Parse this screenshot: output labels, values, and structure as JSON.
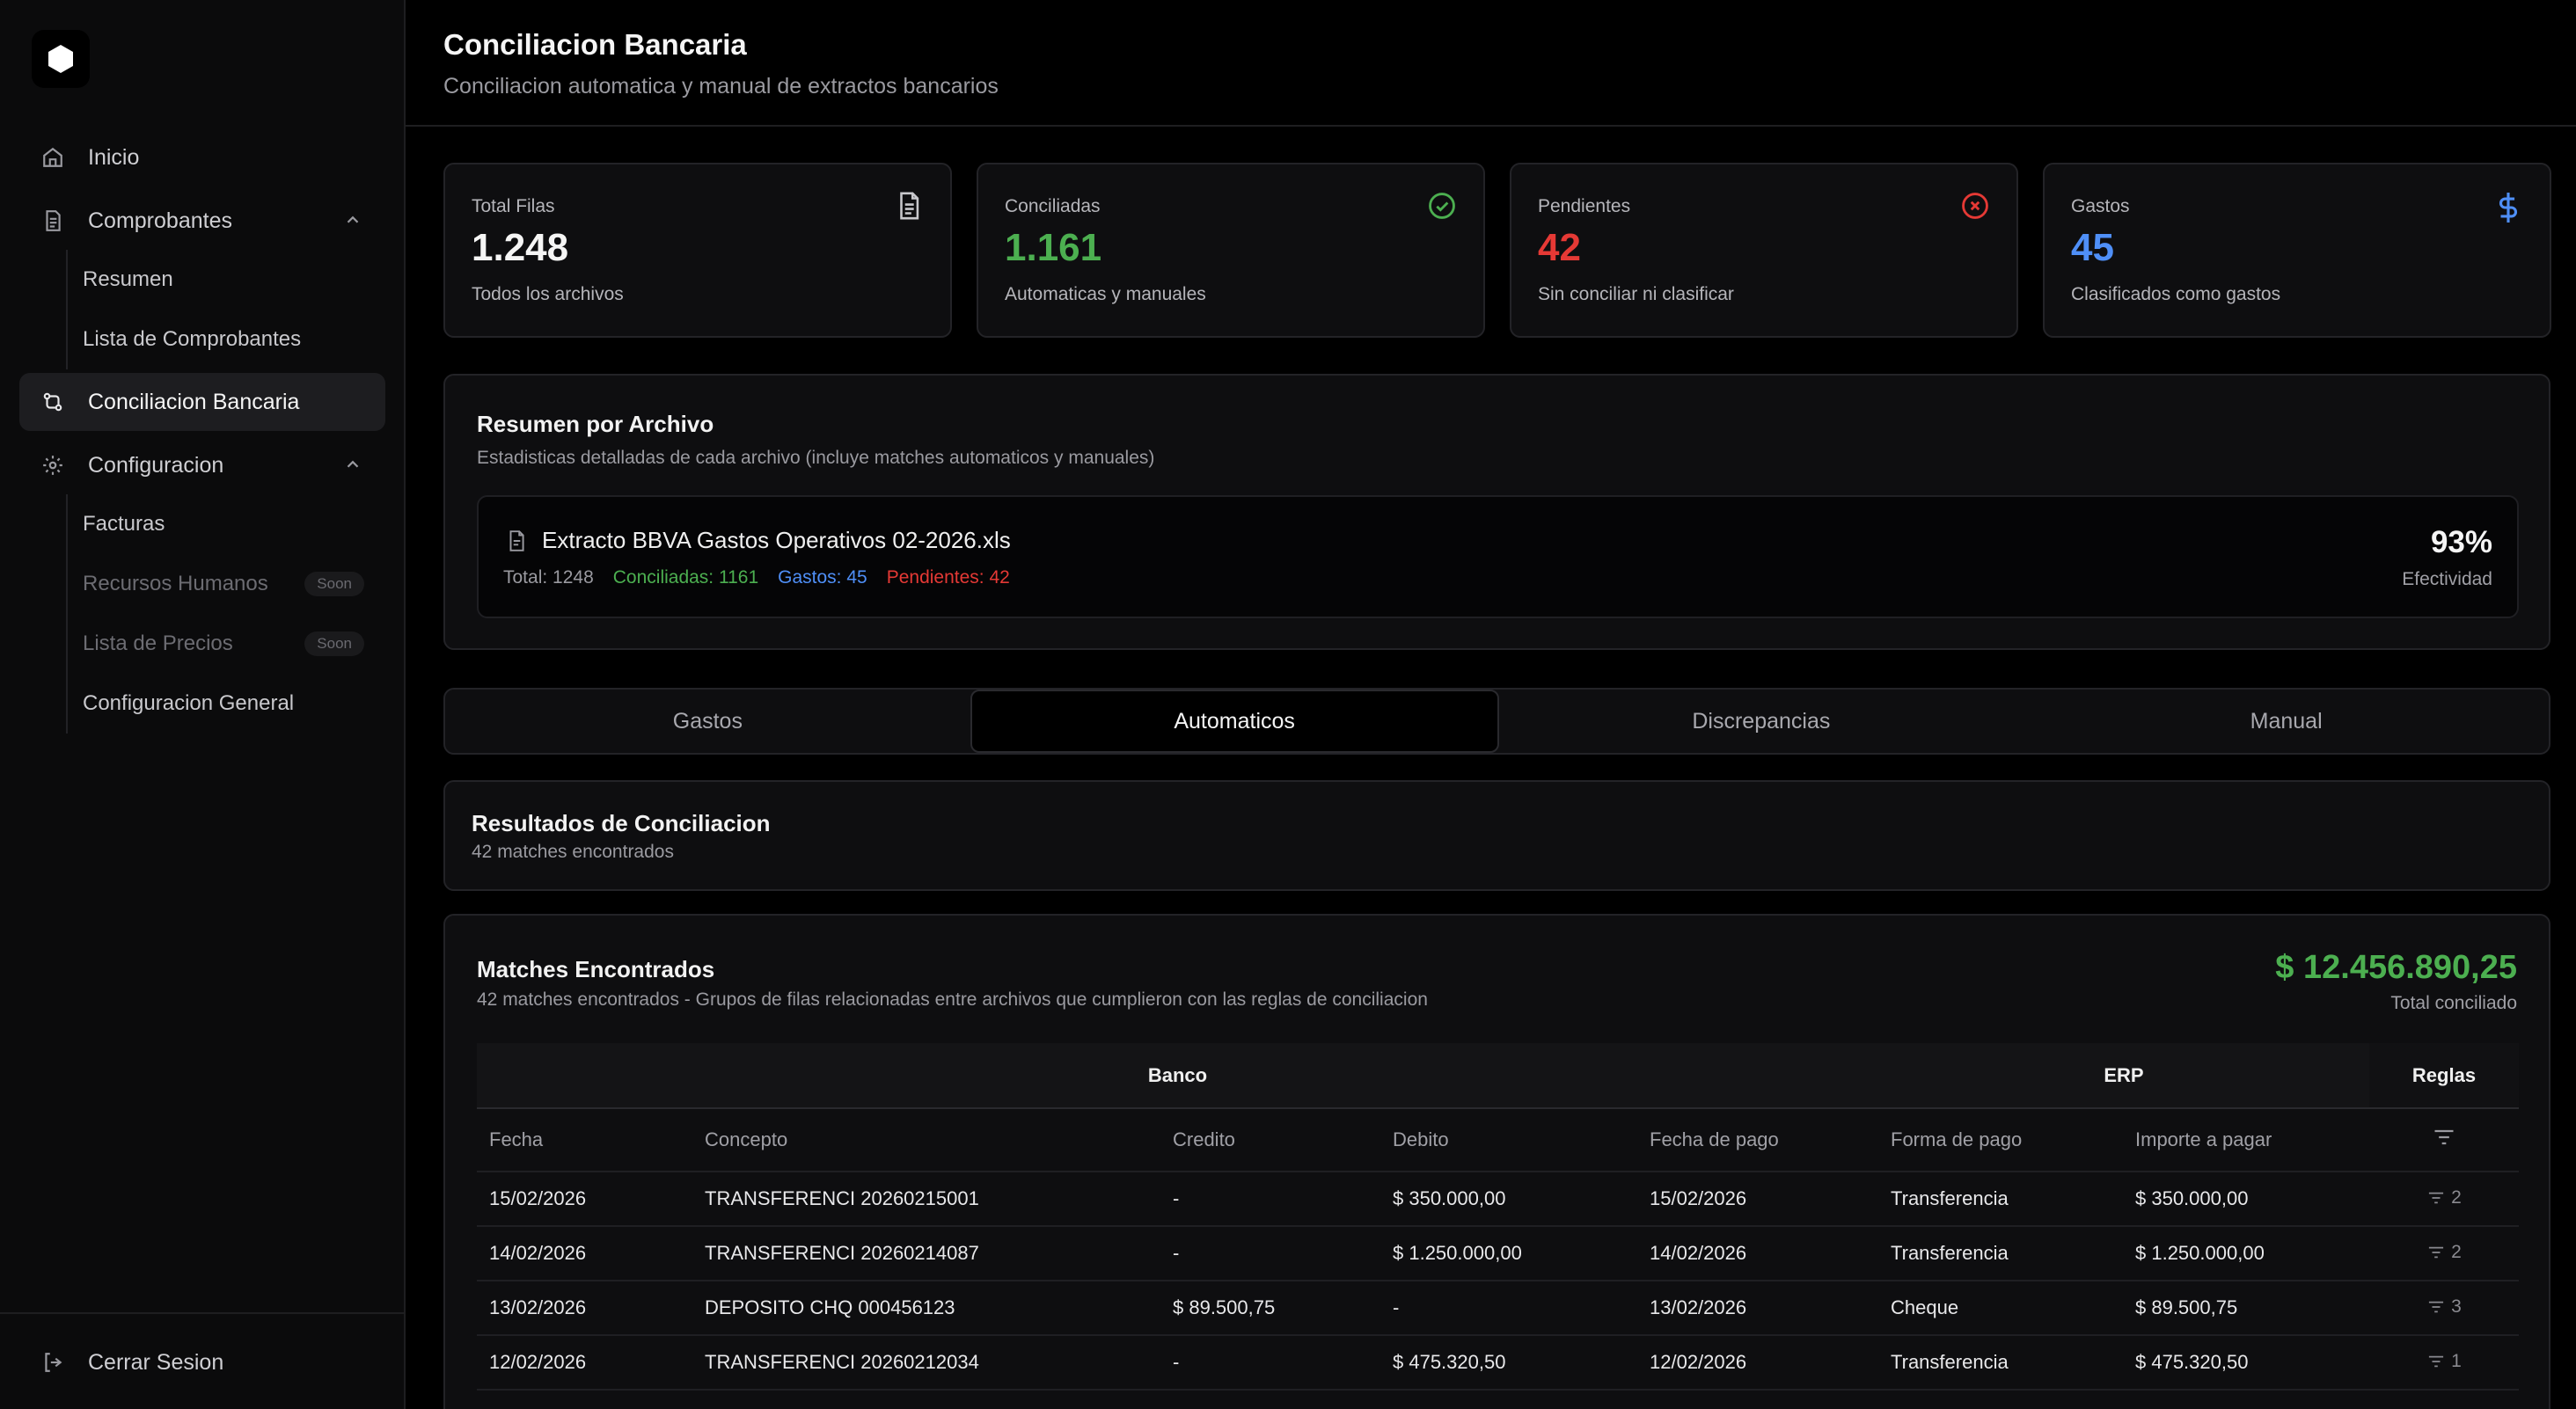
{
  "sidebar": {
    "nav": {
      "inicio": "Inicio",
      "comprobantes": "Comprobantes",
      "resumen": "Resumen",
      "lista_comprobantes": "Lista de Comprobantes",
      "conciliacion": "Conciliacion Bancaria",
      "configuracion": "Configuracion",
      "facturas": "Facturas",
      "recursos_humanos": "Recursos Humanos",
      "lista_precios": "Lista de Precios",
      "config_general": "Configuracion General",
      "soon": "Soon"
    },
    "logout": "Cerrar Sesion"
  },
  "header": {
    "title": "Conciliacion Bancaria",
    "subtitle": "Conciliacion automatica y manual de extractos bancarios"
  },
  "stats": [
    {
      "label": "Total Filas",
      "value": "1.248",
      "desc": "Todos los archivos",
      "color": "#f5f5f5",
      "icon": "file-icon"
    },
    {
      "label": "Conciliadas",
      "value": "1.161",
      "desc": "Automaticas y manuales",
      "color": "#4caf50",
      "icon": "check-circle-icon"
    },
    {
      "label": "Pendientes",
      "value": "42",
      "desc": "Sin conciliar ni clasificar",
      "color": "#e53935",
      "icon": "x-circle-icon"
    },
    {
      "label": "Gastos",
      "value": "45",
      "desc": "Clasificados como gastos",
      "color": "#4f8ff7",
      "icon": "dollar-icon"
    }
  ],
  "summary": {
    "title": "Resumen por Archivo",
    "desc": "Estadisticas detalladas de cada archivo (incluye matches automaticos y manuales)",
    "file": {
      "name": "Extracto BBVA Gastos Operativos 02-2026.xls",
      "total": "Total: 1248",
      "conciliadas": "Conciliadas: 1161",
      "gastos": "Gastos: 45",
      "pendientes": "Pendientes: 42",
      "pct": "93%",
      "pct_label": "Efectividad"
    }
  },
  "tabs": [
    "Gastos",
    "Automaticos",
    "Discrepancias",
    "Manual"
  ],
  "results": {
    "title": "Resultados de Conciliacion",
    "desc": "42 matches encontrados"
  },
  "matches": {
    "title": "Matches Encontrados",
    "desc": "42 matches encontrados - Grupos de filas relacionadas entre archivos que cumplieron con las reglas de conciliacion",
    "total": "$ 12.456.890,25",
    "total_label": "Total conciliado",
    "groups": {
      "banco": "Banco",
      "erp": "ERP",
      "reglas": "Reglas"
    },
    "columns": [
      "Fecha",
      "Concepto",
      "Credito",
      "Debito",
      "Fecha de pago",
      "Forma de pago",
      "Importe a pagar"
    ],
    "rows": [
      [
        "15/02/2026",
        "TRANSFERENCI 20260215001",
        "-",
        "$ 350.000,00",
        "15/02/2026",
        "Transferencia",
        "$ 350.000,00",
        "2"
      ],
      [
        "14/02/2026",
        "TRANSFERENCI 20260214087",
        "-",
        "$ 1.250.000,00",
        "14/02/2026",
        "Transferencia",
        "$ 1.250.000,00",
        "2"
      ],
      [
        "13/02/2026",
        "DEPOSITO CHQ 000456123",
        "$ 89.500,75",
        "-",
        "13/02/2026",
        "Cheque",
        "$ 89.500,75",
        "3"
      ],
      [
        "12/02/2026",
        "TRANSFERENCI 20260212034",
        "-",
        "$ 475.320,50",
        "12/02/2026",
        "Transferencia",
        "$ 475.320,50",
        "1"
      ]
    ]
  }
}
